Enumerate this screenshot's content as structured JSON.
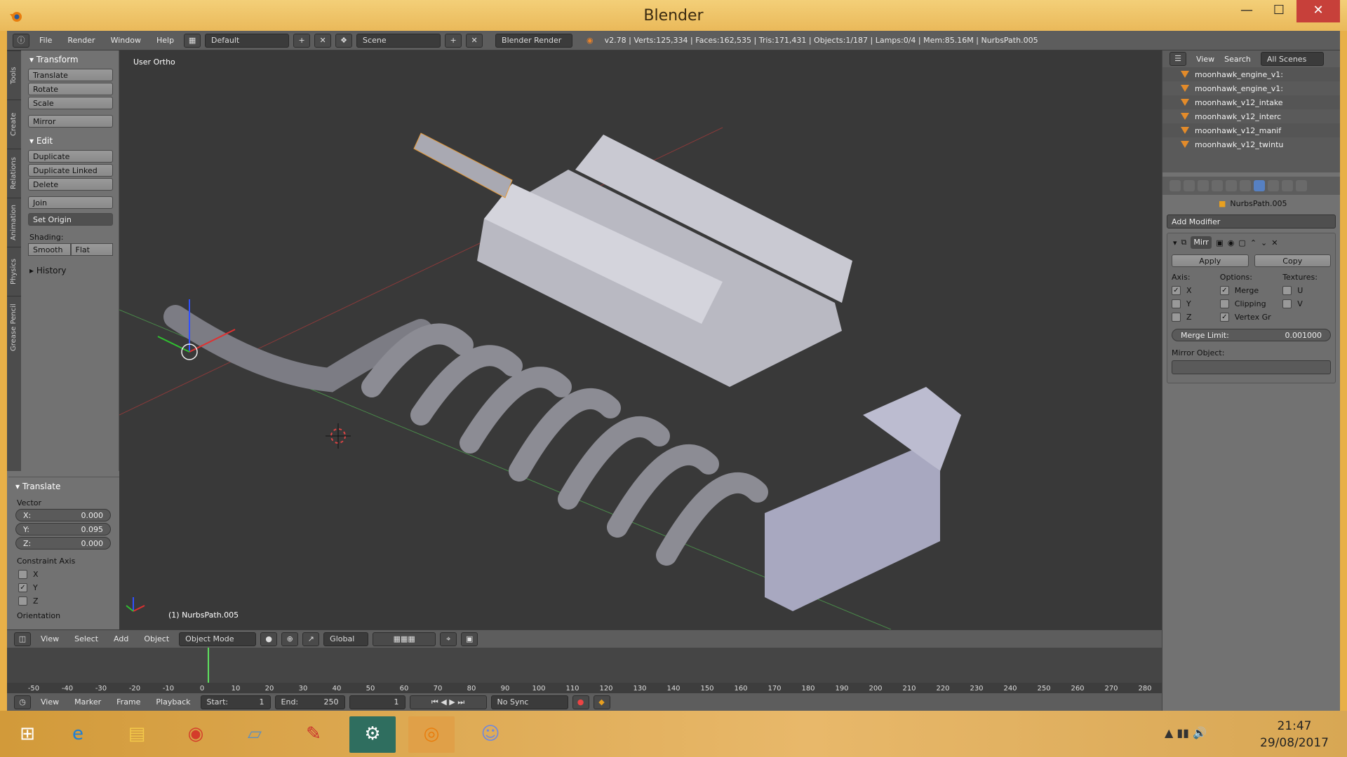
{
  "window": {
    "title": "Blender",
    "min": "—",
    "max": "☐",
    "close": "✕"
  },
  "menubar": {
    "items": [
      "File",
      "Render",
      "Window",
      "Help"
    ],
    "layout": "Default",
    "scene": "Scene",
    "engine": "Blender Render",
    "info": "v2.78 | Verts:125,334 | Faces:162,535 | Tris:171,431 | Objects:1/187 | Lamps:0/4 | Mem:85.16M | NurbsPath.005"
  },
  "left_tabs": [
    "Tools",
    "Create",
    "Relations",
    "Animation",
    "Physics",
    "Grease Pencil"
  ],
  "toolshelf": {
    "transform_header": "Transform",
    "transform_buttons": [
      "Translate",
      "Rotate",
      "Scale"
    ],
    "mirror": "Mirror",
    "edit_header": "Edit",
    "edit_buttons": [
      "Duplicate",
      "Duplicate Linked",
      "Delete"
    ],
    "join": "Join",
    "set_origin": "Set Origin",
    "shading_label": "Shading:",
    "smooth": "Smooth",
    "flat": "Flat",
    "history": "History"
  },
  "redo": {
    "header": "Translate",
    "vector_label": "Vector",
    "x": {
      "label": "X:",
      "value": "0.000"
    },
    "y": {
      "label": "Y:",
      "value": "0.095"
    },
    "z": {
      "label": "Z:",
      "value": "0.000"
    },
    "constraint_label": "Constraint Axis",
    "axes": [
      {
        "label": "X",
        "checked": false
      },
      {
        "label": "Y",
        "checked": true
      },
      {
        "label": "Z",
        "checked": false
      }
    ],
    "orientation": "Orientation"
  },
  "viewport": {
    "view_label": "User Ortho",
    "object_label": "(1) NurbsPath.005"
  },
  "view3d_header": {
    "items": [
      "View",
      "Select",
      "Add",
      "Object"
    ],
    "mode": "Object Mode",
    "orientation": "Global"
  },
  "timeline": {
    "ticks": [
      "-50",
      "-40",
      "-30",
      "-20",
      "-10",
      "0",
      "10",
      "20",
      "30",
      "40",
      "50",
      "60",
      "70",
      "80",
      "90",
      "100",
      "110",
      "120",
      "130",
      "140",
      "150",
      "160",
      "170",
      "180",
      "190",
      "200",
      "210",
      "220",
      "230",
      "240",
      "250",
      "260",
      "270",
      "280"
    ]
  },
  "timeline_header": {
    "items": [
      "View",
      "Marker",
      "Frame",
      "Playback"
    ],
    "start_label": "Start:",
    "start": "1",
    "end_label": "End:",
    "end": "250",
    "current": "1",
    "sync": "No Sync"
  },
  "outliner": {
    "header": [
      "View",
      "Search",
      "All Scenes"
    ],
    "rows": [
      "moonhawk_engine_v1:",
      "moonhawk_engine_v1:",
      "moonhawk_v12_intake",
      "moonhawk_v12_interc",
      "moonhawk_v12_manif",
      "moonhawk_v12_twintu"
    ]
  },
  "properties": {
    "object": "NurbsPath.005",
    "add_modifier": "Add Modifier",
    "modifier_name": "Mirr",
    "apply": "Apply",
    "copy": "Copy",
    "axis_label": "Axis:",
    "options_label": "Options:",
    "textures_label": "Textures:",
    "axis": [
      {
        "label": "X",
        "checked": true
      },
      {
        "label": "Y",
        "checked": false
      },
      {
        "label": "Z",
        "checked": false
      }
    ],
    "options": [
      {
        "label": "Merge",
        "checked": true
      },
      {
        "label": "Clipping",
        "checked": false
      },
      {
        "label": "Vertex Gr",
        "checked": true
      }
    ],
    "textures": [
      {
        "label": "U",
        "checked": false
      },
      {
        "label": "V",
        "checked": false
      }
    ],
    "merge_limit_label": "Merge Limit:",
    "merge_limit": "0.001000",
    "mirror_object_label": "Mirror Object:"
  },
  "taskbar": {
    "time": "21:47",
    "date": "29/08/2017"
  }
}
